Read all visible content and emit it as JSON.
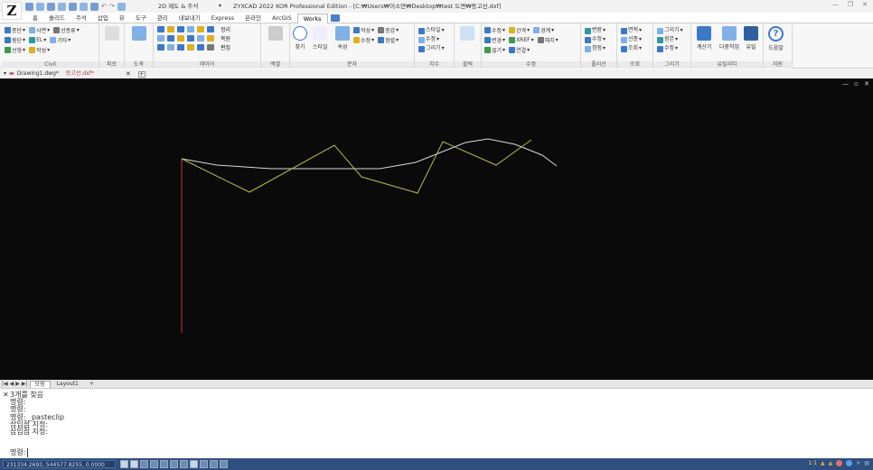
{
  "app": {
    "logo_letter": "Z",
    "workspace": "2D 제도 & 주석",
    "window_title": "ZYXCAD 2022 KOR Professional Edition - [C:₩Users₩이소연₩Desktop₩test 도면₩등고선.dxf]"
  },
  "ribbon_tabs": [
    {
      "label": "홈"
    },
    {
      "label": "솔리드"
    },
    {
      "label": "주석"
    },
    {
      "label": "삽입"
    },
    {
      "label": "뷰"
    },
    {
      "label": "도구"
    },
    {
      "label": "관리"
    },
    {
      "label": "내보내기"
    },
    {
      "label": "Express"
    },
    {
      "label": "온라인"
    },
    {
      "label": "ArcGIS"
    },
    {
      "label": "Works"
    }
  ],
  "active_tab": "Works",
  "panels": {
    "civil": {
      "title": "Civil",
      "row1": [
        "종단",
        "사면",
        "선종류"
      ],
      "row2": [
        "횡단",
        "EL",
        "기타"
      ],
      "row3": [
        "선형",
        "작성"
      ]
    },
    "pyoro": {
      "title": "피로"
    },
    "dogak": {
      "title": "도곽"
    },
    "layer": {
      "title": "레이어",
      "items": [
        "정리",
        "복원",
        "편집"
      ]
    },
    "excel": {
      "title": "엑셀"
    },
    "text": {
      "title": "문자",
      "buttons": [
        "찾기",
        "스타일",
        "속성"
      ],
      "row1": [
        "작성",
        "증감"
      ],
      "row2": [
        "수정",
        "정렬"
      ]
    },
    "dimension": {
      "title": "치수",
      "items": [
        "스타일",
        "수정",
        "그리기"
      ]
    },
    "block": {
      "title": "블럭"
    },
    "modify": {
      "title": "수정",
      "row1": [
        "수정",
        "간격",
        "경계"
      ],
      "row2": [
        "변경",
        "XREF",
        "해치"
      ],
      "row3": [
        "끊기",
        "연결"
      ]
    },
    "polyline": {
      "title": "폴리선",
      "items": [
        "변환",
        "수정",
        "정점"
      ]
    },
    "query": {
      "title": "조회",
      "items": [
        "면적",
        "선종",
        "조회"
      ]
    },
    "draw": {
      "title": "그리기",
      "items": [
        "그리기",
        "원본",
        "수정"
      ]
    },
    "utility": {
      "title": "유틸리티",
      "buttons": [
        "계산기",
        "다중작업",
        "유틸"
      ]
    },
    "support": {
      "title": "지원",
      "buttons": [
        "도움말"
      ]
    }
  },
  "file_tabs": [
    {
      "label": "Drawing1.dwg*"
    },
    {
      "label": "등고선.dxf*"
    }
  ],
  "layout_tabs": [
    {
      "label": "모형"
    },
    {
      "label": "Layout1"
    },
    {
      "label": "+"
    }
  ],
  "command_history": [
    "3개를 찾음",
    "명령:",
    "명령:",
    "명령: _pasteclip",
    "삽입점 지정:",
    "삽입점 지정:"
  ],
  "command_prompt": "명령:",
  "status_coords": "231334.2693, 544577.8255, 0.0000",
  "status_right": "1:1",
  "colors": {
    "canvas_bg": "#0a0a0a",
    "red_line": "#c83030",
    "white_line": "#d8d8d8",
    "yellow_line": "#b8b84a"
  }
}
